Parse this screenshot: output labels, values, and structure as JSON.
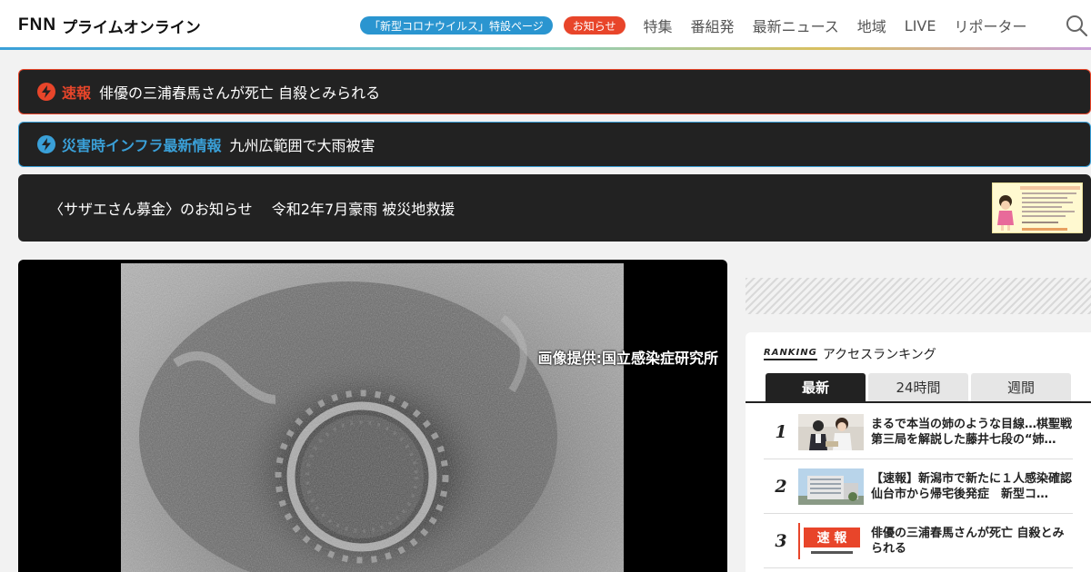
{
  "header": {
    "logo_fnn": "FNN",
    "logo_text": "プライムオンライン",
    "corona_pill": "「新型コロナウイルス」特設ページ",
    "notice_pill": "お知らせ",
    "nav": [
      "特集",
      "番組発",
      "最新ニュース",
      "地域",
      "LIVE",
      "リポーター"
    ],
    "colors": {
      "corona": "#2a95d0",
      "notice": "#e8452a"
    }
  },
  "banners": {
    "breaking": {
      "label": "速報",
      "text": "俳優の三浦春馬さんが死亡 自殺とみられる",
      "color": "#e8452a"
    },
    "disaster": {
      "label": "災害時インフラ最新情報",
      "text": "九州広範囲で大雨被害",
      "color": "#3aa0d8"
    },
    "sazae": {
      "text": "〈サザエさん募金〉のお知らせ　 令和2年7月豪雨 被災地救援"
    }
  },
  "hero": {
    "credit": "画像提供:国立感染症研究所"
  },
  "ranking": {
    "label_en": "RANKING",
    "label_jp": "アクセスランキング",
    "tabs": [
      "最新",
      "24時間",
      "週間"
    ],
    "active_tab": "最新",
    "items": [
      {
        "rank": "1",
        "title": "まるで本当の姉のような目線…棋聖戦第三局を解説した藤井七段の“姉…"
      },
      {
        "rank": "2",
        "title": "【速報】新潟市で新たに１人感染確認　仙台市から帰宅後発症　新型コ…"
      },
      {
        "rank": "3",
        "title": "俳優の三浦春馬さんが死亡 自殺とみられる",
        "thumb_label": "速 報"
      }
    ]
  }
}
